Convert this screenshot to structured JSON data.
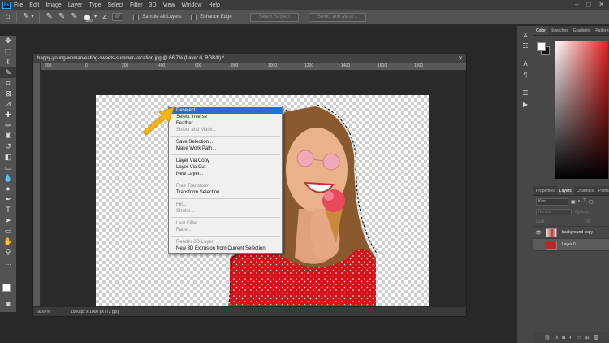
{
  "menubar": {
    "items": [
      "File",
      "Edit",
      "Image",
      "Layer",
      "Type",
      "Select",
      "Filter",
      "3D",
      "View",
      "Window",
      "Help"
    ]
  },
  "options": {
    "brush_size": "100",
    "angle": "0°",
    "sample_all_layers": "Sample All Layers",
    "enhance_edge": "Enhance Edge",
    "select_subject": "Select Subject",
    "select_and_mask": "Select and Mask..."
  },
  "document": {
    "title": "happy-young-woman-eating-sweets-summer-vacation.jpg @ 66.7% (Layer 0, RGB/8) *",
    "ruler_ticks": [
      "200",
      "0",
      "200",
      "400",
      "600",
      "800",
      "1000",
      "1200",
      "1400",
      "1600",
      "1800"
    ],
    "zoom": "66.67%",
    "info": "1500 px x 1000 px (72 ppi)"
  },
  "context_menu": {
    "groups": [
      [
        {
          "label": "Deselect",
          "state": "hover"
        },
        {
          "label": "Select Inverse",
          "state": "enabled"
        },
        {
          "label": "Feather...",
          "state": "enabled"
        },
        {
          "label": "Select and Mask...",
          "state": "disabled"
        }
      ],
      [
        {
          "label": "Save Selection...",
          "state": "enabled"
        },
        {
          "label": "Make Work Path...",
          "state": "enabled"
        }
      ],
      [
        {
          "label": "Layer Via Copy",
          "state": "enabled"
        },
        {
          "label": "Layer Via Cut",
          "state": "enabled"
        },
        {
          "label": "New Layer...",
          "state": "enabled"
        }
      ],
      [
        {
          "label": "Free Transform",
          "state": "disabled"
        },
        {
          "label": "Transform Selection",
          "state": "enabled"
        }
      ],
      [
        {
          "label": "Fill...",
          "state": "disabled"
        },
        {
          "label": "Stroke...",
          "state": "disabled"
        }
      ],
      [
        {
          "label": "Last Filter",
          "state": "disabled"
        },
        {
          "label": "Fade...",
          "state": "disabled"
        }
      ],
      [
        {
          "label": "Render 3D Layer",
          "state": "disabled"
        },
        {
          "label": "New 3D Extrusion from Current Selection",
          "state": "enabled"
        }
      ]
    ]
  },
  "color_panel": {
    "tabs": [
      "Color",
      "Swatches",
      "Gradients",
      "Patterns"
    ],
    "accent": "#e31d1d"
  },
  "layers_panel": {
    "tabs": [
      "Properties",
      "Layers",
      "Channels",
      "Paths"
    ],
    "kind_label": "Kind",
    "blend_mode": "Normal",
    "opacity_label": "Opacity",
    "lock_label": "Lock",
    "fill_label": "Fill",
    "layers": [
      {
        "name": "background copy",
        "visible": true,
        "selected": false
      },
      {
        "name": "Layer 0",
        "visible": false,
        "selected": true
      }
    ]
  }
}
